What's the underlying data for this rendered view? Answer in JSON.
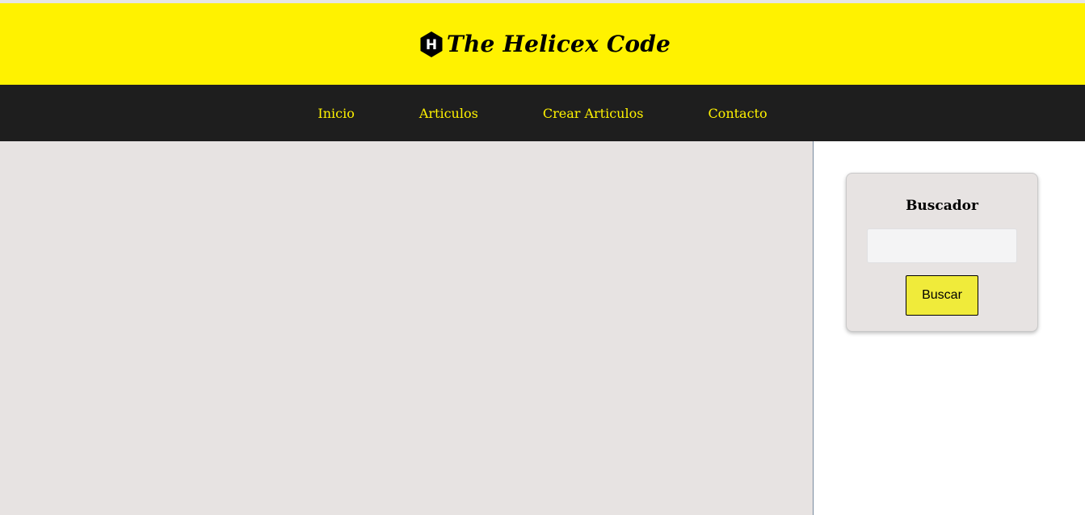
{
  "site": {
    "title": "The Helicex Code",
    "logo_letter": "H",
    "logo_icon": "hexagon-h-logo-icon"
  },
  "nav": {
    "items": [
      {
        "label": "Inicio"
      },
      {
        "label": "Articulos"
      },
      {
        "label": "Crear Articulos"
      },
      {
        "label": "Contacto"
      }
    ]
  },
  "sidebar": {
    "search": {
      "title": "Buscador",
      "input_value": "",
      "placeholder": "",
      "button_label": "Buscar"
    }
  },
  "colors": {
    "brand_yellow": "#fff200",
    "nav_background": "#1e1e1e",
    "content_background": "#e7e3e2",
    "button_yellow": "#f0eb3a"
  }
}
